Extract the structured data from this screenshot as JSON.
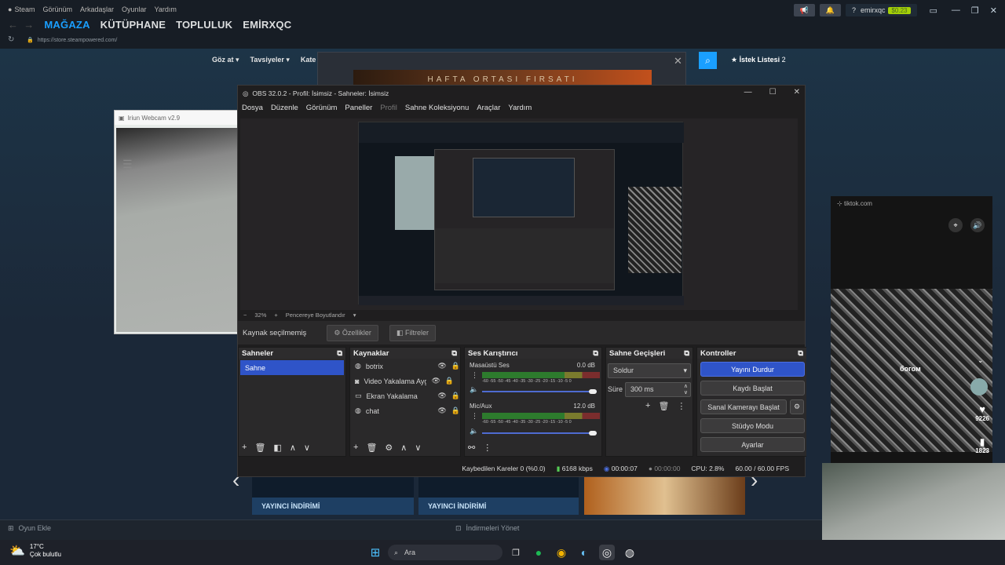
{
  "steam": {
    "menu": [
      "Steam",
      "Görünüm",
      "Arkadaşlar",
      "Oyunlar",
      "Yardım"
    ],
    "nav": [
      "MAĞAZA",
      "KÜTÜPHANE",
      "TOPLULUK",
      "EMİRXQC"
    ],
    "url": "https://store.steampowered.com/",
    "user": "emirxqc",
    "wallet": "$0.23",
    "store_nav": [
      "Göz at ▾",
      "Tavsiyeler ▾",
      "Kate"
    ],
    "wishlist": "İstek Listesi",
    "wishlist_count": "2",
    "banner_text": "HAFTA ORTASI FIRSATI",
    "streamer_label": "YAYINCI İNDİRİMİ",
    "add_game": "Oyun Ekle",
    "manage_downloads": "İndirmeleri Yönet"
  },
  "iriun": {
    "title": "Iriun Webcam v2.9"
  },
  "tiktok": {
    "url": "tiktok.com",
    "likes": "9226",
    "saves": "1823",
    "caption": "богом"
  },
  "obs": {
    "title": "OBS 32.0.2 - Profil: İsimsiz - Sahneler: İsimsiz",
    "menu": [
      "Dosya",
      "Düzenle",
      "Görünüm",
      "Paneller",
      "Profil",
      "Sahne Koleksiyonu",
      "Araçlar",
      "Yardım"
    ],
    "zoom": "32%",
    "resize": "Pencereye Boyutlandır",
    "source_status": "Kaynak seçilmemiş",
    "properties": "Özellikler",
    "filters": "Filtreler",
    "docks": {
      "scenes": "Sahneler",
      "sources": "Kaynaklar",
      "mixer": "Ses Karıştırıcı",
      "transitions": "Sahne Geçişleri",
      "controls": "Kontroller"
    },
    "scenes": [
      "Sahne"
    ],
    "sources": [
      "botrix",
      "Video Yakalama Aygıtı",
      "Ekran Yakalama",
      "chat"
    ],
    "mixer": [
      {
        "name": "Masaüstü Ses",
        "db": "0.0 dB"
      },
      {
        "name": "Mic/Aux",
        "db": "12.0 dB"
      }
    ],
    "meter_scale": "-60 -55 -50 -45 -40 -35 -30 -25 -20 -15 -10 -5 0",
    "transition": "Soldur",
    "duration_label": "Süre",
    "duration": "300 ms",
    "controls": [
      "Yayını Durdur",
      "Kaydı Başlat",
      "Sanal Kamerayı Başlat",
      "Stüdyo Modu",
      "Ayarlar"
    ],
    "status": {
      "dropped": "Kaybedilen Kareler 0 (%0.0)",
      "bitrate": "6168 kbps",
      "stream_time": "00:00:07",
      "rec_time": "00:00:00",
      "cpu": "CPU: 2.8%",
      "fps": "60.00 / 60.00 FPS"
    }
  },
  "taskbar": {
    "temp": "17°C",
    "weather": "Çok bulutlu",
    "search": "Ara"
  },
  "colors": {
    "steam_blue": "#1a9fff",
    "obs_accent": "#2f54c8",
    "wallet": "#a4d007"
  }
}
